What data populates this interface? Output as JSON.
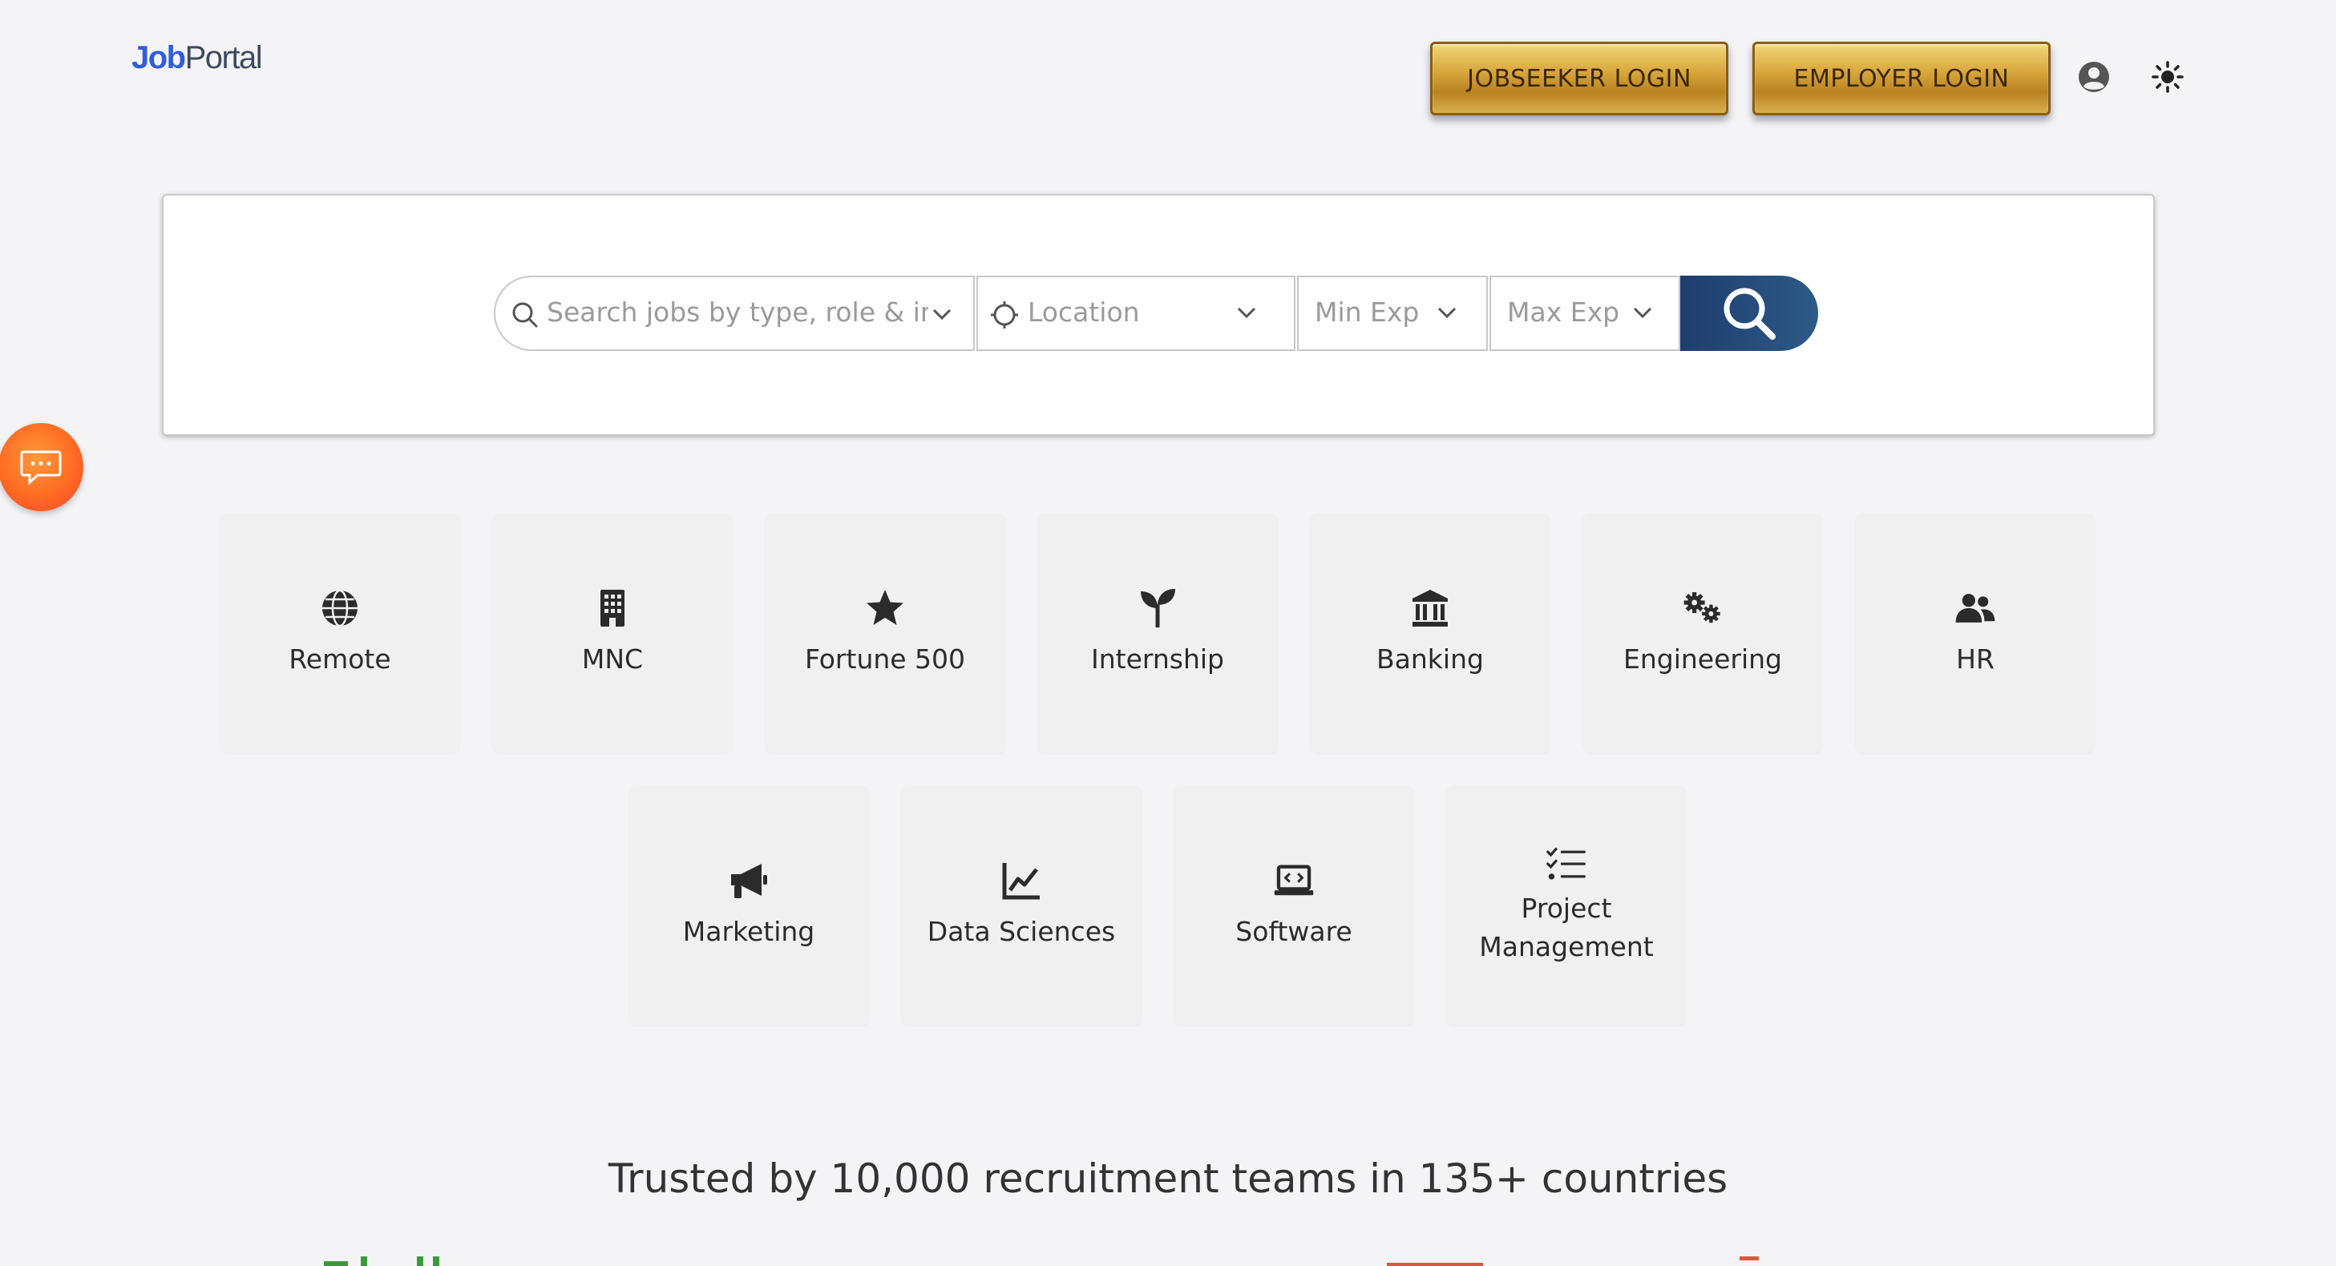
{
  "header": {
    "logo_job": "Job",
    "logo_portal": "Portal",
    "jobseeker_login": "JOBSEEKER LOGIN",
    "employer_login": "EMPLOYER LOGIN",
    "user_icon": "user-circle-icon",
    "theme_icon": "sun-icon"
  },
  "search": {
    "keyword_placeholder": "Search jobs by type, role & inc",
    "location_placeholder": "Location",
    "min_exp_placeholder": "Min Exp",
    "max_exp_placeholder": "Max Exp",
    "button_icon": "search-icon"
  },
  "categories": [
    {
      "label": "Remote",
      "icon": "globe-icon"
    },
    {
      "label": "MNC",
      "icon": "building-icon"
    },
    {
      "label": "Fortune 500",
      "icon": "star-icon"
    },
    {
      "label": "Internship",
      "icon": "seedling-icon"
    },
    {
      "label": "Banking",
      "icon": "bank-icon"
    },
    {
      "label": "Engineering",
      "icon": "gears-icon"
    },
    {
      "label": "HR",
      "icon": "users-icon"
    },
    {
      "label": "Marketing",
      "icon": "megaphone-icon"
    },
    {
      "label": "Data Sciences",
      "icon": "chart-line-icon"
    },
    {
      "label": "Software",
      "icon": "laptop-code-icon"
    },
    {
      "label": "Project Management",
      "icon": "list-check-icon"
    }
  ],
  "trusted_text": "Trusted by 10,000 recruitment teams in 135+ countries",
  "colors": {
    "brand_blue": "#2f5fd8",
    "gold": "#d8a73c",
    "search_button": "#1f3d6e",
    "chat_orange": "#ff6a22"
  }
}
